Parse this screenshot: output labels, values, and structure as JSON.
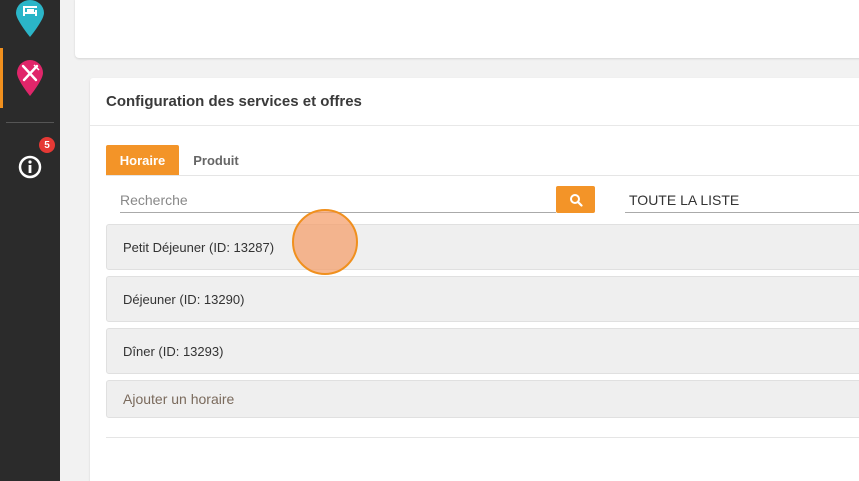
{
  "sidebar": {
    "notification_count": "5",
    "colors": {
      "background": "#2b2b2b",
      "accent": "#f0901e",
      "hotel_pin": "#2bb5c8",
      "restaurant_pin": "#e0266a",
      "badge": "#e53935"
    }
  },
  "panel": {
    "title": "Configuration des services et offres",
    "tabs": [
      {
        "label": "Horaire",
        "active": true
      },
      {
        "label": "Produit",
        "active": false
      }
    ],
    "search": {
      "placeholder": "Recherche",
      "value": ""
    },
    "filter": {
      "selected": "TOUTE LA LISTE"
    },
    "schedules": [
      {
        "label": "Petit Déjeuner (ID: 13287)"
      },
      {
        "label": "Déjeuner (ID: 13290)"
      },
      {
        "label": "Dîner (ID: 13293)"
      }
    ],
    "add_label": "Ajouter un horaire"
  },
  "accent_color": "#f39428"
}
